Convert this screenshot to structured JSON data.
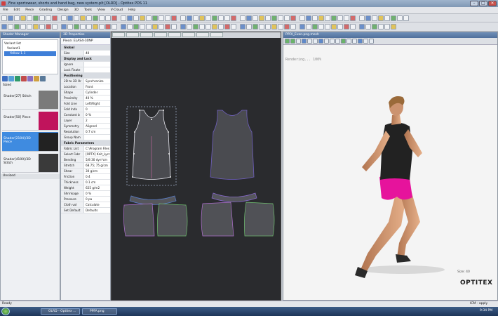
{
  "window": {
    "title": "Fine sportswear, shorts and hand bag, new system.plt [OLRD] - Optitex PDS 11"
  },
  "menu": [
    "File",
    "Edit",
    "Piece",
    "Grading",
    "Design",
    "3D",
    "Tools",
    "View",
    "V-Cloud",
    "Help"
  ],
  "shader_manager": {
    "title": "Shader Manager",
    "tree": [
      "Variant list",
      "Variant1",
      "Yellow 1.1"
    ],
    "group_label": "Sized",
    "items": [
      {
        "label": "Shader[27] Stitch",
        "color": "#7a7a7a"
      },
      {
        "label": "Shader[50] Piece",
        "color": "#c0145c"
      },
      {
        "label": "Shader[2104]/3D Piece",
        "color": "#222222"
      },
      {
        "label": "Shader[4100]/3D Stitch",
        "color": "#3a3a3a"
      }
    ],
    "footer": "Unsized"
  },
  "properties": {
    "title": "3D Properties",
    "piece_name": "Piece: ELAS4-10NP",
    "rows": [
      {
        "k": "Global",
        "head": true
      },
      {
        "k": "Size",
        "v": "40"
      },
      {
        "k": "Display and Lock",
        "head": true
      },
      {
        "k": "Ignore",
        "v": ""
      },
      {
        "k": "Lock Fixate",
        "v": ""
      },
      {
        "k": "Positioning",
        "head": true
      },
      {
        "k": "2D to 3D Or",
        "v": "Synchronize"
      },
      {
        "k": "Location",
        "v": "Front"
      },
      {
        "k": "Shape",
        "v": "Cylinder"
      },
      {
        "k": "Proximity",
        "v": "40 %"
      },
      {
        "k": "Fold Line",
        "v": "Left/Right"
      },
      {
        "k": "Fold Indx",
        "v": "0"
      },
      {
        "k": "Constant b",
        "v": "0 %"
      },
      {
        "k": "Layer",
        "v": "2"
      },
      {
        "k": "Symmetry",
        "v": "Aligned"
      },
      {
        "k": "Resolution",
        "v": "0.7 cm"
      },
      {
        "k": "Group Nam",
        "v": ""
      },
      {
        "k": "Fabric Parameters",
        "head": true
      },
      {
        "k": "Fabric List",
        "v": "C:\\Program Files"
      },
      {
        "k": "Select Fabr",
        "v": "[OPTX] Knit_Lycra"
      },
      {
        "k": "Bending",
        "v": "5/8 30 dyn*cm"
      },
      {
        "k": "Stretch",
        "v": "68.75; 75 g/cm"
      },
      {
        "k": "Shear",
        "v": "30 g/cm"
      },
      {
        "k": "Friction",
        "v": "0.4"
      },
      {
        "k": "Thickness",
        "v": "0.1 cm"
      },
      {
        "k": "Weight",
        "v": "625 g/m2"
      },
      {
        "k": "Shrinkage",
        "v": "0 %"
      },
      {
        "k": "Pressure",
        "v": "0 pa"
      },
      {
        "k": "Cloth vol",
        "v": "Calculate"
      },
      {
        "k": "Set Default",
        "v": "Defaults"
      }
    ]
  },
  "view3d": {
    "title": "PPFA_Evan.png.mesh",
    "rendering": "Rendering... 100%",
    "size_label": "Size: 40",
    "brand": "OPTITEX"
  },
  "statusbar": {
    "left": "Ready",
    "right": "ICM - apply"
  },
  "taskbar": {
    "items": [
      "OLRD - Optitex ...",
      "PPFA.png"
    ],
    "clock": "9:34 PM"
  }
}
